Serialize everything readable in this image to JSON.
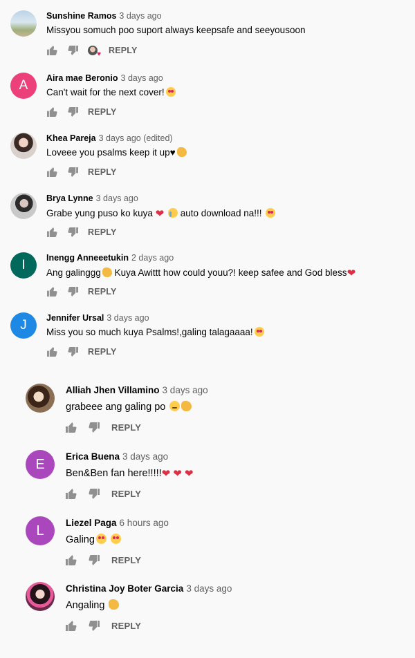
{
  "comments": [
    {
      "name": "Sunshine Ramos",
      "time": "3 days ago",
      "text": "Missyou somuch poo suport always keepsafe and seeyousoon",
      "reply": "REPLY",
      "avatar_letter": "",
      "avatar_color": "",
      "hearted": true
    },
    {
      "name": "Aira mae Beronio",
      "time": "3 days ago",
      "text": "Can't wait for the next cover!",
      "reply": "REPLY",
      "avatar_letter": "A",
      "avatar_color": "#ec407a"
    },
    {
      "name": "Khea Pareja",
      "time": "3 days ago (edited)",
      "text": "Loveee you psalms keep it up♥",
      "reply": "REPLY",
      "avatar_letter": "",
      "avatar_color": ""
    },
    {
      "name": "Brya Lynne",
      "time": "3 days ago",
      "text_parts": [
        "Grabe yung puso ko kuya ",
        "auto download na!!! "
      ],
      "reply": "REPLY",
      "avatar_letter": "",
      "avatar_color": ""
    },
    {
      "name": "Inengg Anneeetukin",
      "time": "2 days ago",
      "text_parts": [
        "Ang galinggg",
        " Kuya Awittt how could youu?! keep safee and God bless"
      ],
      "reply": "REPLY",
      "avatar_letter": "I",
      "avatar_color": "#00695c"
    },
    {
      "name": "Jennifer Ursal",
      "time": "3 days ago",
      "text": "Miss you so much kuya Psalms!,galing talagaaaa!",
      "reply": "REPLY",
      "avatar_letter": "J",
      "avatar_color": "#1e88e5"
    }
  ],
  "replies": [
    {
      "name": "Alliah Jhen Villamino",
      "time": "3 days ago",
      "text": "grabeee ang galing po ",
      "reply": "REPLY",
      "avatar_letter": "",
      "avatar_color": ""
    },
    {
      "name": "Erica Buena",
      "time": "3 days ago",
      "text": "Ben&Ben fan here!!!!!",
      "reply": "REPLY",
      "avatar_letter": "E",
      "avatar_color": "#ab47bc"
    },
    {
      "name": "Liezel Paga",
      "time": "6 hours ago",
      "text": "Galing",
      "reply": "REPLY",
      "avatar_letter": "L",
      "avatar_color": "#ab47bc"
    },
    {
      "name": "Christina Joy Boter Garcia",
      "time": "3 days ago",
      "text": "Angaling ",
      "reply": "REPLY",
      "avatar_letter": "",
      "avatar_color": ""
    }
  ],
  "icons": {
    "like": "thumbs-up-icon",
    "dislike": "thumbs-down-icon",
    "heart": "creator-heart-icon"
  }
}
